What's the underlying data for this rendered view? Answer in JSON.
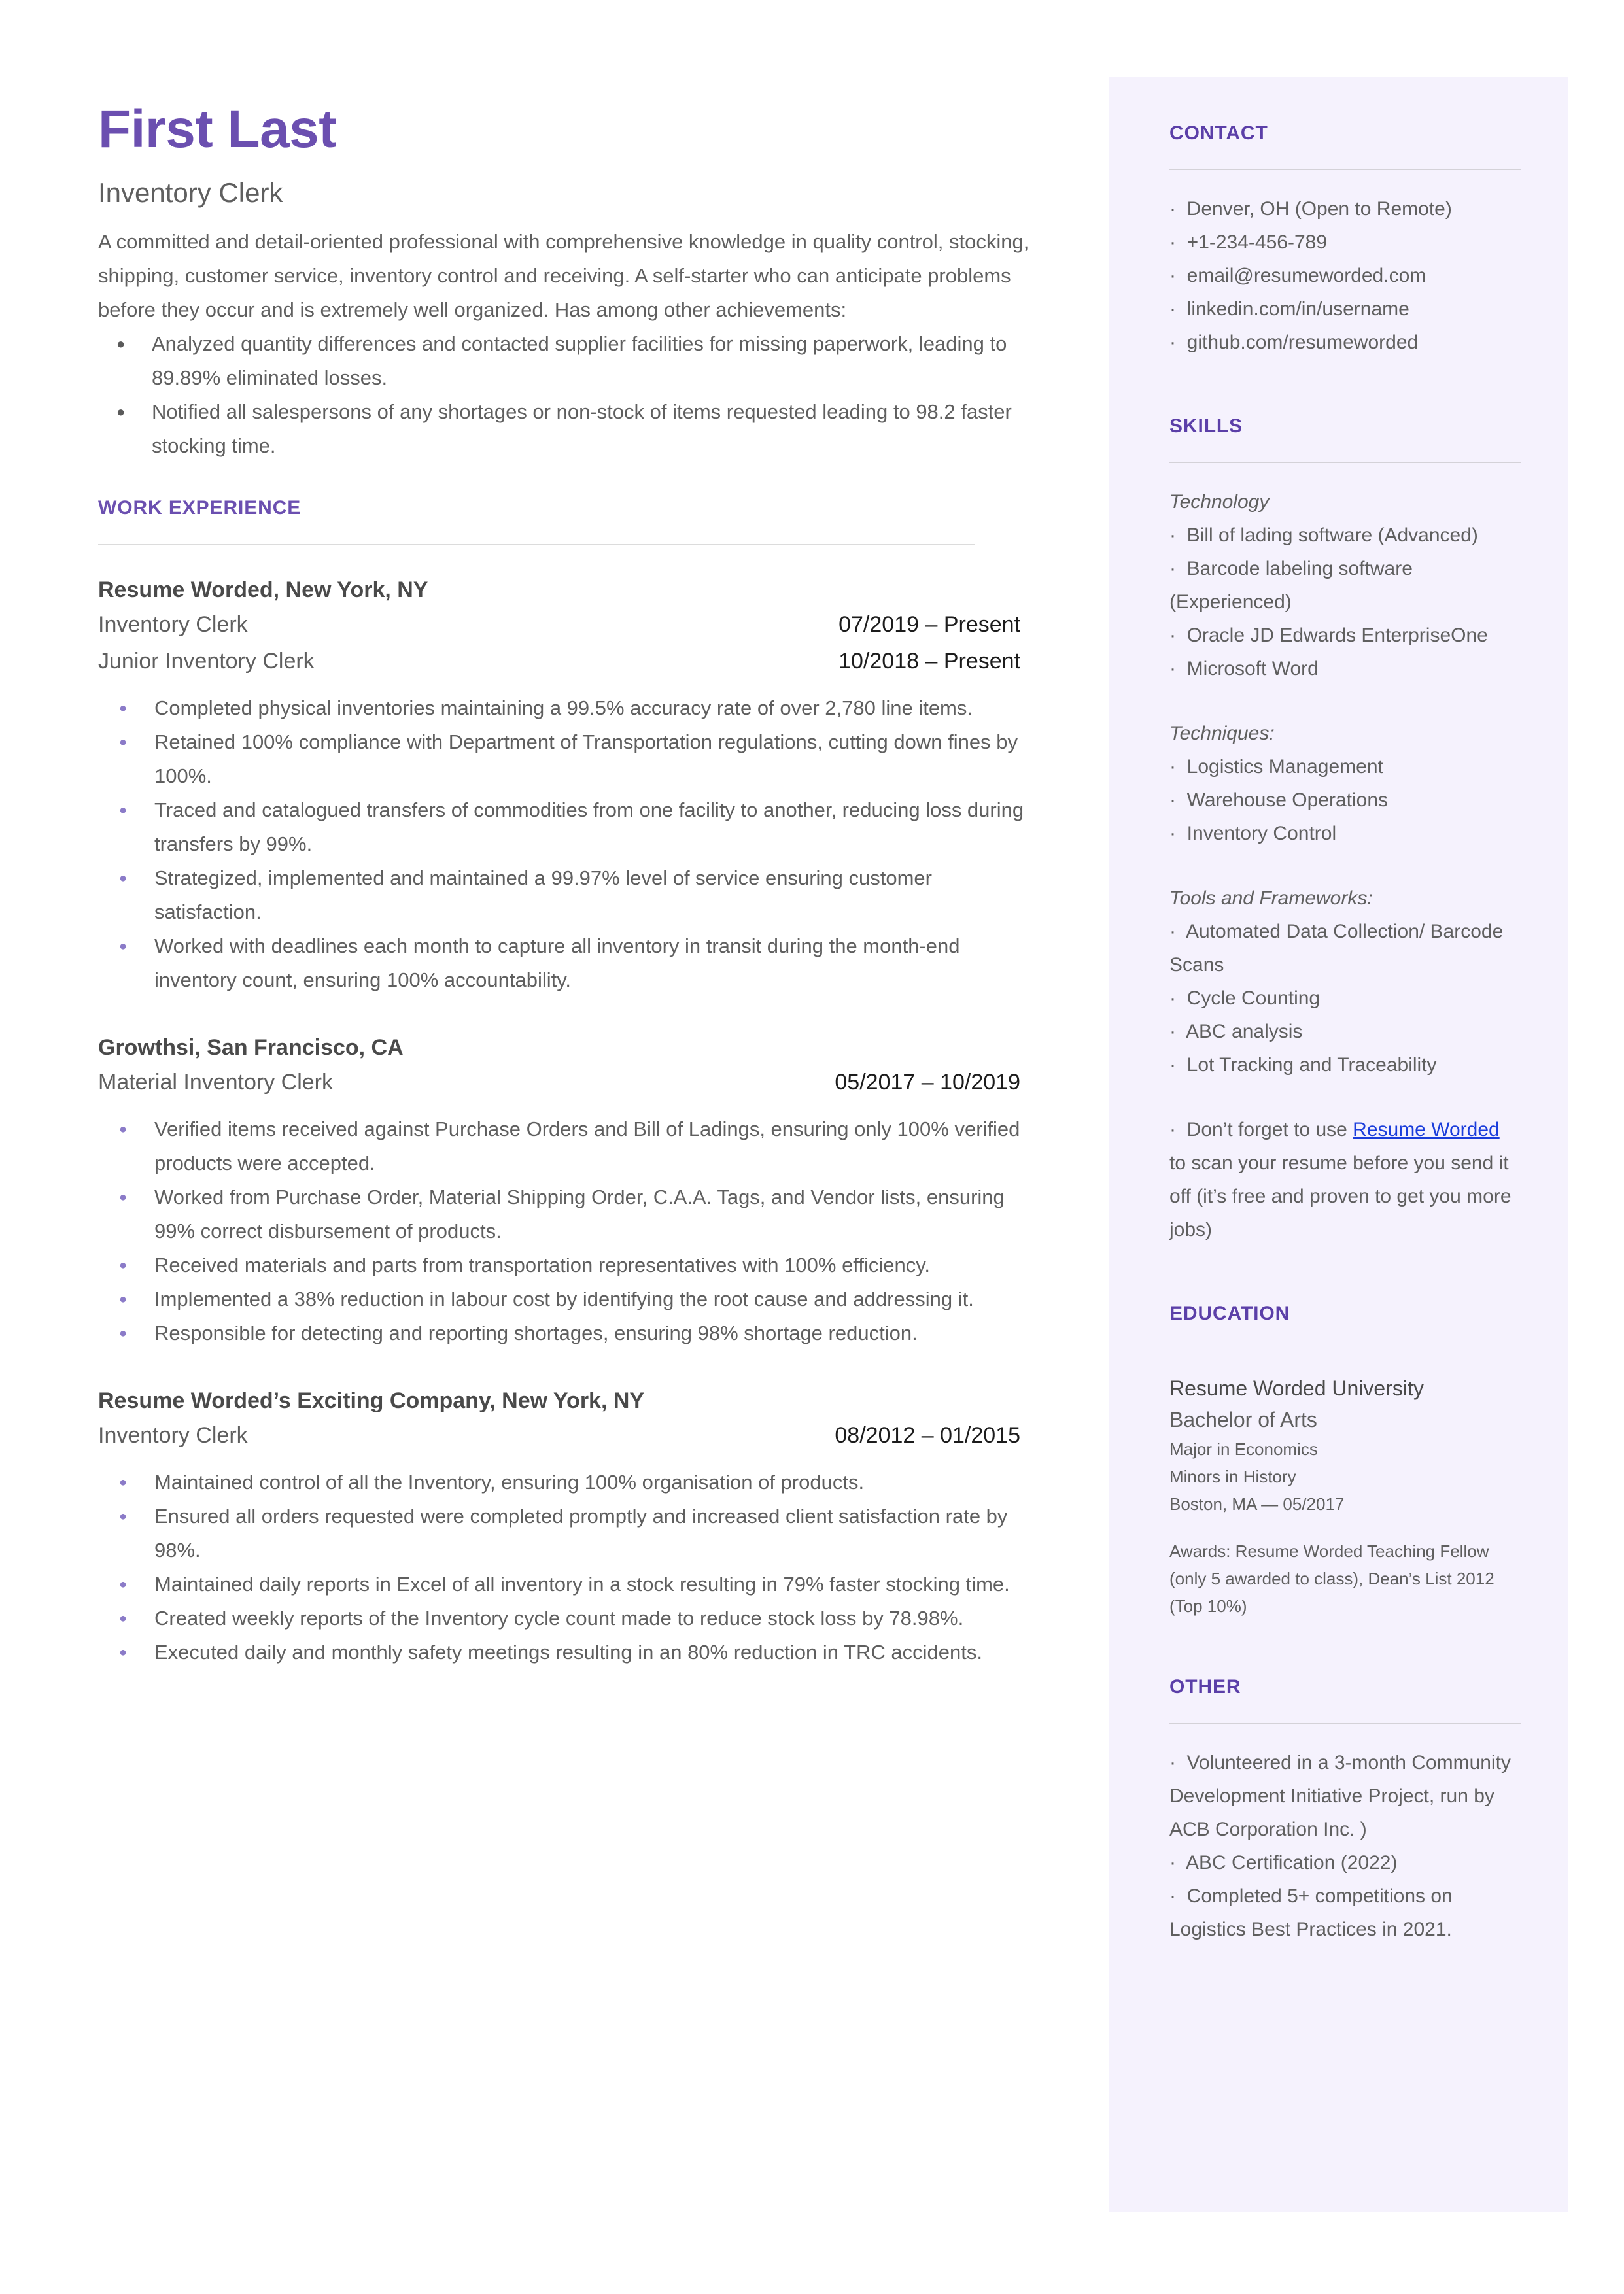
{
  "header": {
    "name": "First Last",
    "role": "Inventory Clerk",
    "summary": "A committed and detail-oriented professional with comprehensive knowledge in quality control, stocking, shipping, customer service, inventory control and receiving. A self-starter who can anticipate problems before they occur and is extremely well organized. Has among other achievements:",
    "achievements": [
      "Analyzed quantity differences and contacted supplier facilities for missing paperwork, leading to 89.89% eliminated losses.",
      "Notified all salespersons of any shortages or non-stock of items requested leading to 98.2 faster stocking time."
    ]
  },
  "work_experience": {
    "section_title": "WORK EXPERIENCE",
    "jobs": [
      {
        "company": "Resume Worded, New York, NY",
        "roles": [
          {
            "title": "Inventory Clerk",
            "dates": "07/2019 – Present"
          },
          {
            "title": "Junior Inventory Clerk",
            "dates": "10/2018 – Present"
          }
        ],
        "bullets": [
          "Completed physical inventories maintaining a 99.5% accuracy rate of over 2,780 line items.",
          "Retained 100% compliance with Department of Transportation regulations, cutting down fines by 100%.",
          "Traced and catalogued transfers of commodities from one facility to another, reducing loss during transfers by 99%.",
          "Strategized, implemented and maintained a 99.97% level of service ensuring customer satisfaction.",
          "Worked with deadlines each month to capture all inventory in transit during the month-end inventory count, ensuring 100% accountability."
        ]
      },
      {
        "company": "Growthsi, San Francisco, CA",
        "roles": [
          {
            "title": "Material Inventory Clerk",
            "dates": "05/2017 – 10/2019"
          }
        ],
        "bullets": [
          "Verified items received against Purchase Orders and Bill of Ladings, ensuring only 100% verified products were accepted.",
          "Worked from Purchase Order, Material Shipping Order, C.A.A. Tags, and Vendor lists, ensuring 99% correct disbursement of products.",
          "Received materials and parts from transportation representatives with 100% efficiency.",
          "Implemented a 38% reduction in labour cost by identifying the root cause and addressing it.",
          "Responsible for detecting and reporting shortages, ensuring 98% shortage reduction."
        ]
      },
      {
        "company": "Resume Worded’s Exciting Company, New York, NY",
        "roles": [
          {
            "title": "Inventory Clerk",
            "dates": "08/2012 – 01/2015"
          }
        ],
        "bullets": [
          "Maintained control of all the Inventory, ensuring 100% organisation of products.",
          "Ensured all orders requested were completed promptly and increased client satisfaction rate by 98%.",
          "Maintained daily reports in Excel of all inventory in a stock resulting in 79% faster stocking time.",
          "Created weekly reports of the Inventory cycle count made to reduce stock loss by 78.98%.",
          "Executed daily and monthly safety meetings resulting in an 80% reduction in TRC accidents."
        ]
      }
    ]
  },
  "sidebar": {
    "contact": {
      "title": "CONTACT",
      "items": [
        "Denver, OH (Open to Remote)",
        "+1-234-456-789",
        "email@resumeworded.com",
        "linkedin.com/in/username",
        "github.com/resumeworded"
      ]
    },
    "skills": {
      "title": "SKILLS",
      "groups": [
        {
          "label": "Technology",
          "items": [
            "Bill of lading software (Advanced)",
            "Barcode labeling software (Experienced)",
            "Oracle JD Edwards EnterpriseOne",
            "Microsoft Word"
          ]
        },
        {
          "label": "Techniques:",
          "items": [
            "Logistics Management",
            "Warehouse Operations",
            "Inventory Control"
          ]
        },
        {
          "label": "Tools and Frameworks:",
          "items": [
            "Automated Data Collection/ Barcode Scans",
            "Cycle Counting",
            "ABC analysis",
            "Lot Tracking and Traceability"
          ]
        }
      ],
      "promo": {
        "prefix": "Don’t forget to use ",
        "link_text": "Resume Worded",
        "suffix": " to scan your resume before you send it off (it’s free and proven to get you more jobs)"
      }
    },
    "education": {
      "title": "EDUCATION",
      "school": "Resume Worded University",
      "degree": "Bachelor of Arts",
      "major": "Major in Economics",
      "minor": "Minors in History",
      "location_date": "Boston, MA — 05/2017",
      "awards": "Awards: Resume Worded Teaching Fellow (only 5 awarded to class), Dean’s List 2012 (Top 10%)"
    },
    "other": {
      "title": "OTHER",
      "items": [
        "Volunteered in a 3-month Community Development Initiative Project, run by ACB Corporation Inc. )",
        "ABC Certification (2022)",
        "Completed 5+ competitions on Logistics Best Practices in 2021."
      ]
    }
  },
  "colors": {
    "accent_purple": "#6b4fb0",
    "sidebar_bg": "#f5f2fd",
    "link_blue": "#1a3ddb",
    "body_gray": "#5f5f5f"
  }
}
